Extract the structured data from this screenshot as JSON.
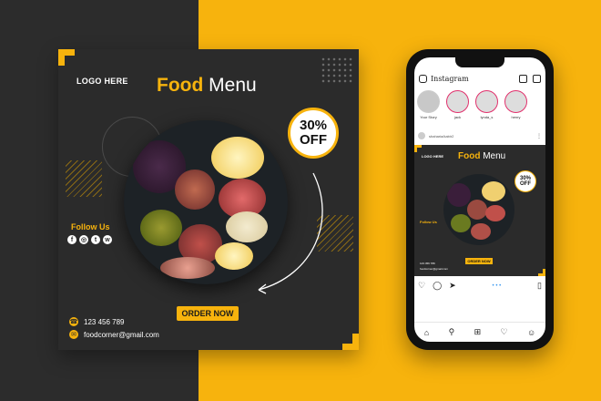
{
  "post": {
    "logo": "LOGO HERE",
    "title_accent": "Food",
    "title_rest": " Menu",
    "discount_pct": "30%",
    "discount_off": "OFF",
    "follow": "Follow Us",
    "social": [
      "f",
      "◎",
      "t",
      "w"
    ],
    "order": "ORDER NOW",
    "phone": "123 456 789",
    "email": "foodcorner@gmail.com"
  },
  "phone_ui": {
    "app_name": "Instagram",
    "stories": [
      "Your Story",
      "jack",
      "lynda_s",
      "henry"
    ],
    "username": "shaharia/kabir2",
    "mini_logo": "LOGO HERE",
    "mini_title_accent": "Food",
    "mini_title_rest": " Menu",
    "mini_pct": "30%",
    "mini_off": "OFF",
    "mini_follow": "Follow Us",
    "mini_order": "ORDER NOW",
    "mini_phone": "123 456 789",
    "mini_email": "foodcorner@gmail.com"
  },
  "colors": {
    "accent": "#f7b30d",
    "dark": "#2b2b2b"
  }
}
